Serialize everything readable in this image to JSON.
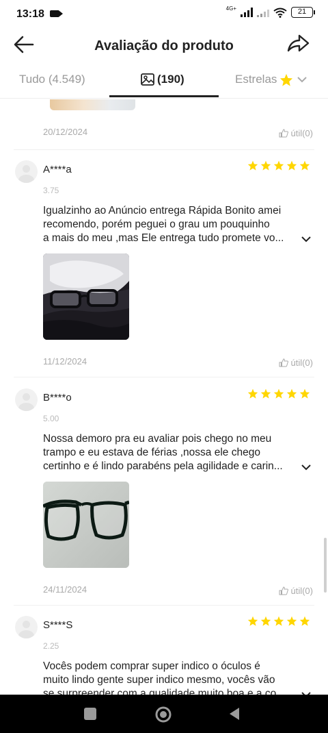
{
  "status_bar": {
    "time": "13:18",
    "network": "4G+",
    "battery": "21"
  },
  "header": {
    "title": "Avaliação do produto",
    "back_icon": "arrow-left-icon",
    "share_icon": "share-icon"
  },
  "tabs": {
    "all_label": "Tudo (4.549)",
    "photos_label": "(190)",
    "stars_label": "Estrelas"
  },
  "colors": {
    "star": "#FFD600",
    "accent": "#222222",
    "muted": "#AAAAAA"
  },
  "first_footer": {
    "date": "20/12/2024",
    "useful": "útil(0)"
  },
  "reviews": [
    {
      "user": "A****a",
      "rating": "3.75",
      "stars": 5,
      "lines": [
        "Igualzinho ao Anúncio  entrega Rápida Bonito amei",
        "recomendo, porém peguei o grau um pouquinho",
        "a mais do meu ,mas Ele entrega tudo promete  vo..."
      ],
      "date": "11/12/2024",
      "useful": "útil(0)"
    },
    {
      "user": "B****o",
      "rating": "5.00",
      "stars": 5,
      "lines": [
        "Nossa demoro pra eu avaliar pois chego no meu",
        "trampo e eu  estava de férias ,nossa ele chego",
        "certinho e é lindo parabéns pela agilidade e carin..."
      ],
      "date": "24/11/2024",
      "useful": "útil(0)"
    },
    {
      "user": "S****S",
      "rating": "2.25",
      "stars": 5,
      "lines": [
        "Vocês podem comprar super indico o óculos é",
        "muito lindo gente super indico mesmo, vocês vão",
        "se surpreender com a qualidade muito boa e a co..."
      ]
    }
  ]
}
